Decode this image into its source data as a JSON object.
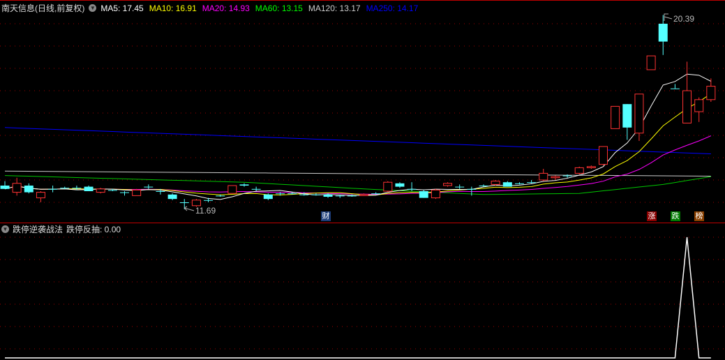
{
  "header": {
    "title": "南天信息(日线,前复权)",
    "ma_labels": [
      {
        "text": "MA5: 17.45",
        "color": "#ffffff"
      },
      {
        "text": "MA10: 16.91",
        "color": "#ffff00"
      },
      {
        "text": "MA20: 14.93",
        "color": "#ff00ff"
      },
      {
        "text": "MA60: 13.15",
        "color": "#00ff00"
      },
      {
        "text": "MA120: 13.17",
        "color": "#cccccc"
      },
      {
        "text": "MA250: 14.17",
        "color": "#0000ff"
      }
    ]
  },
  "indicator": {
    "name": "跌停逆袭战法",
    "value_label": "跌停反抽: 0.00"
  },
  "markers": {
    "cai": "财",
    "zhang": "涨",
    "die": "跌",
    "bang": "榜"
  },
  "chart_data": {
    "type": "candlestick",
    "title": "南天信息(日线,前复权)",
    "high_label": "20.39",
    "low_label": "11.69",
    "ylim": [
      11.5,
      20.4
    ],
    "colors": {
      "up": "#ff3232",
      "down": "#54ffff",
      "ma5": "#ffffff",
      "ma10": "#ffff00",
      "ma20": "#ff00ff",
      "ma60": "#00c800",
      "ma120": "#cccccc",
      "ma250": "#0000ff"
    },
    "ohlc": [
      [
        12.75,
        12.95,
        12.6,
        12.6
      ],
      [
        12.45,
        13.1,
        12.3,
        12.85
      ],
      [
        12.75,
        12.85,
        12.4,
        12.45
      ],
      [
        12.2,
        12.5,
        12.0,
        12.45
      ],
      [
        12.6,
        12.75,
        12.45,
        12.6
      ],
      [
        12.65,
        12.7,
        12.6,
        12.65
      ],
      [
        12.65,
        12.75,
        12.55,
        12.65
      ],
      [
        12.7,
        12.75,
        12.5,
        12.5
      ],
      [
        12.45,
        12.65,
        12.4,
        12.6
      ],
      [
        12.55,
        12.6,
        12.5,
        12.55
      ],
      [
        12.45,
        12.5,
        12.3,
        12.45
      ],
      [
        12.3,
        12.6,
        12.3,
        12.55
      ],
      [
        12.7,
        12.8,
        12.6,
        12.7
      ],
      [
        12.5,
        12.6,
        12.35,
        12.5
      ],
      [
        12.35,
        12.4,
        12.1,
        12.15
      ],
      [
        12.0,
        12.15,
        11.69,
        12.0
      ],
      [
        11.85,
        12.15,
        11.8,
        12.1
      ],
      [
        12.1,
        12.2,
        12.0,
        12.1
      ],
      [
        12.3,
        12.35,
        12.25,
        12.3
      ],
      [
        12.4,
        12.75,
        12.4,
        12.75
      ],
      [
        12.8,
        12.85,
        12.7,
        12.75
      ],
      [
        12.6,
        12.7,
        12.5,
        12.6
      ],
      [
        12.35,
        12.4,
        12.1,
        12.15
      ],
      [
        12.4,
        12.45,
        12.3,
        12.4
      ],
      [
        12.4,
        12.45,
        12.35,
        12.4
      ],
      [
        12.35,
        12.45,
        12.3,
        12.35
      ],
      [
        12.35,
        12.4,
        12.3,
        12.35
      ],
      [
        12.35,
        12.4,
        12.2,
        12.25
      ],
      [
        12.3,
        12.35,
        12.2,
        12.3
      ],
      [
        12.3,
        12.35,
        12.25,
        12.3
      ],
      [
        12.3,
        12.4,
        12.3,
        12.35
      ],
      [
        12.4,
        12.45,
        12.35,
        12.4
      ],
      [
        12.5,
        12.95,
        12.45,
        12.9
      ],
      [
        12.85,
        12.9,
        12.65,
        12.7
      ],
      [
        12.6,
        12.9,
        12.5,
        12.6
      ],
      [
        12.5,
        12.55,
        12.2,
        12.2
      ],
      [
        12.2,
        12.6,
        12.15,
        12.55
      ],
      [
        12.75,
        12.9,
        12.7,
        12.85
      ],
      [
        12.7,
        12.8,
        12.6,
        12.7
      ],
      [
        12.6,
        12.7,
        12.3,
        12.6
      ],
      [
        12.75,
        12.8,
        12.7,
        12.75
      ],
      [
        12.8,
        13.0,
        12.75,
        12.95
      ],
      [
        12.9,
        12.95,
        12.7,
        12.7
      ],
      [
        12.85,
        12.9,
        12.8,
        12.85
      ],
      [
        12.9,
        13.0,
        12.85,
        12.9
      ],
      [
        13.0,
        13.5,
        12.95,
        13.3
      ],
      [
        13.1,
        13.2,
        13.0,
        13.15
      ],
      [
        13.2,
        13.25,
        13.1,
        13.2
      ],
      [
        13.3,
        13.6,
        13.25,
        13.55
      ],
      [
        13.55,
        13.65,
        13.5,
        13.6
      ],
      [
        13.7,
        14.5,
        13.65,
        14.5
      ],
      [
        15.3,
        16.3,
        15.3,
        16.3
      ],
      [
        16.4,
        16.4,
        14.8,
        15.35
      ],
      [
        15.1,
        16.85,
        14.75,
        16.85
      ],
      [
        17.94,
        18.56,
        17.94,
        18.56
      ],
      [
        20.0,
        20.39,
        18.6,
        19.2
      ],
      [
        17.1,
        17.3,
        17.1,
        17.1
      ],
      [
        15.55,
        18.3,
        15.55,
        17.0
      ],
      [
        16.06,
        16.7,
        15.6,
        16.6
      ],
      [
        16.6,
        17.55,
        16.5,
        17.2
      ]
    ],
    "ma60_points": [
      [
        0,
        13.2
      ],
      [
        10,
        13.05
      ],
      [
        20,
        12.9
      ],
      [
        30,
        12.6
      ],
      [
        40,
        12.35
      ],
      [
        48,
        12.4
      ],
      [
        55,
        12.8
      ],
      [
        59,
        13.15
      ]
    ],
    "ma120_points": [
      [
        0,
        13.4
      ],
      [
        59,
        13.17
      ]
    ],
    "ma250_points": [
      [
        0,
        15.35
      ],
      [
        59,
        14.17
      ]
    ],
    "indicator_values": [
      0,
      0,
      0,
      0,
      0,
      0,
      0,
      0,
      0,
      0,
      0,
      0,
      0,
      0,
      0,
      0,
      0,
      0,
      0,
      0,
      0,
      0,
      0,
      0,
      0,
      0,
      0,
      0,
      0,
      0,
      0,
      0,
      0,
      0,
      0,
      0,
      0,
      0,
      0,
      0,
      0,
      0,
      0,
      0,
      0,
      0,
      0,
      0,
      0,
      0,
      0,
      0,
      0,
      0,
      0,
      0,
      0,
      1,
      0,
      0
    ]
  }
}
